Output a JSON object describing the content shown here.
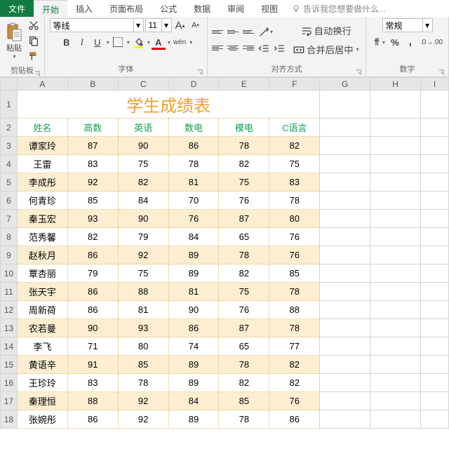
{
  "menu": {
    "file": "文件",
    "tabs": [
      "开始",
      "插入",
      "页面布局",
      "公式",
      "数据",
      "审阅",
      "视图"
    ],
    "active_index": 0,
    "tell_me": "告诉我您想要做什么..."
  },
  "ribbon": {
    "clipboard": {
      "paste": "粘贴",
      "label": "剪贴板"
    },
    "font": {
      "name": "等线",
      "size": "11",
      "bold": "B",
      "italic": "I",
      "underline": "U",
      "ruby": "wén",
      "grow": "A",
      "shrink": "A",
      "label": "字体"
    },
    "alignment": {
      "wrap": "自动换行",
      "merge": "合并后居中",
      "label": "对齐方式"
    },
    "number": {
      "format": "常规",
      "label": "数字"
    }
  },
  "sheet": {
    "columns": [
      "A",
      "B",
      "C",
      "D",
      "E",
      "F",
      "G",
      "H",
      "I"
    ],
    "title": "学生成绩表",
    "headers": [
      "姓名",
      "高数",
      "英语",
      "数电",
      "模电",
      "C语言"
    ],
    "rows": [
      {
        "n": "谭家玲",
        "s": [
          87,
          90,
          86,
          78,
          82
        ]
      },
      {
        "n": "王雷",
        "s": [
          83,
          75,
          78,
          82,
          75
        ]
      },
      {
        "n": "李成彤",
        "s": [
          92,
          82,
          81,
          75,
          83
        ]
      },
      {
        "n": "何青珍",
        "s": [
          85,
          84,
          70,
          76,
          78
        ]
      },
      {
        "n": "秦玉宏",
        "s": [
          93,
          90,
          76,
          87,
          80
        ]
      },
      {
        "n": "范秀馨",
        "s": [
          82,
          79,
          84,
          65,
          76
        ]
      },
      {
        "n": "赵秋月",
        "s": [
          86,
          92,
          89,
          78,
          76
        ]
      },
      {
        "n": "覃杏丽",
        "s": [
          79,
          75,
          89,
          82,
          85
        ]
      },
      {
        "n": "张天宇",
        "s": [
          86,
          88,
          81,
          75,
          78
        ]
      },
      {
        "n": "周新荷",
        "s": [
          86,
          81,
          90,
          76,
          88
        ]
      },
      {
        "n": "农若曼",
        "s": [
          90,
          93,
          86,
          87,
          78
        ]
      },
      {
        "n": "李飞",
        "s": [
          71,
          80,
          74,
          65,
          77
        ]
      },
      {
        "n": "黄语辛",
        "s": [
          91,
          85,
          89,
          78,
          82
        ]
      },
      {
        "n": "王珍玲",
        "s": [
          83,
          78,
          89,
          82,
          82
        ]
      },
      {
        "n": "秦理恒",
        "s": [
          88,
          92,
          84,
          85,
          76
        ]
      },
      {
        "n": "张婉彤",
        "s": [
          86,
          92,
          89,
          78,
          86
        ]
      }
    ]
  },
  "chart_data": {
    "type": "table",
    "title": "学生成绩表",
    "columns": [
      "姓名",
      "高数",
      "英语",
      "数电",
      "模电",
      "C语言"
    ],
    "rows": [
      [
        "谭家玲",
        87,
        90,
        86,
        78,
        82
      ],
      [
        "王雷",
        83,
        75,
        78,
        82,
        75
      ],
      [
        "李成彤",
        92,
        82,
        81,
        75,
        83
      ],
      [
        "何青珍",
        85,
        84,
        70,
        76,
        78
      ],
      [
        "秦玉宏",
        93,
        90,
        76,
        87,
        80
      ],
      [
        "范秀馨",
        82,
        79,
        84,
        65,
        76
      ],
      [
        "赵秋月",
        86,
        92,
        89,
        78,
        76
      ],
      [
        "覃杏丽",
        79,
        75,
        89,
        82,
        85
      ],
      [
        "张天宇",
        86,
        88,
        81,
        75,
        78
      ],
      [
        "周新荷",
        86,
        81,
        90,
        76,
        88
      ],
      [
        "农若曼",
        90,
        93,
        86,
        87,
        78
      ],
      [
        "李飞",
        71,
        80,
        74,
        65,
        77
      ],
      [
        "黄语辛",
        91,
        85,
        89,
        78,
        82
      ],
      [
        "王珍玲",
        83,
        78,
        89,
        82,
        82
      ],
      [
        "秦理恒",
        88,
        92,
        84,
        85,
        76
      ],
      [
        "张婉彤",
        86,
        92,
        89,
        78,
        86
      ]
    ]
  }
}
